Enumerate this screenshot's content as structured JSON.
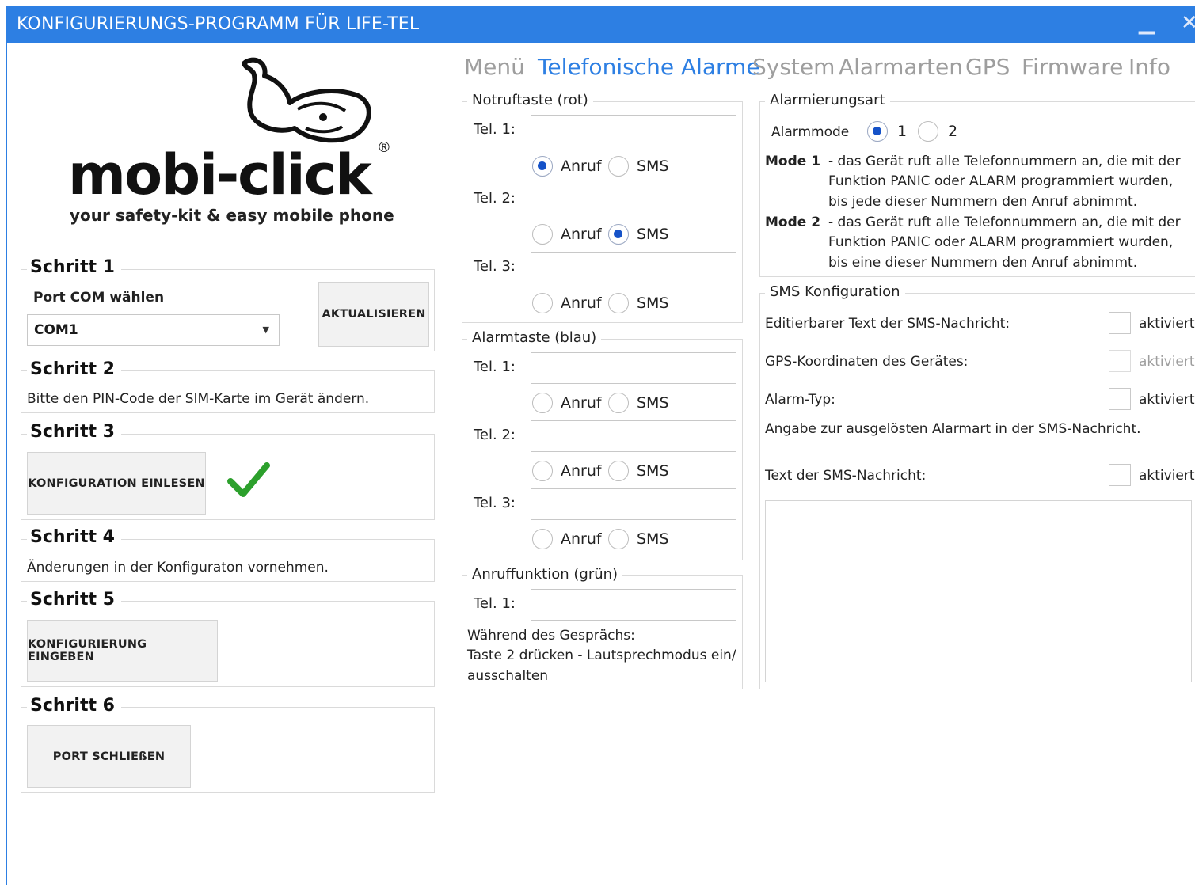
{
  "window": {
    "title": "KONFIGURIERUNGS-PROGRAMM FÜR LIFE-TEL",
    "minimize_glyph": "▁",
    "close_glyph": "✕"
  },
  "logo": {
    "brand": "mobi-click",
    "tagline": "your safety-kit & easy mobile phone",
    "registered": "®"
  },
  "steps": {
    "s1": {
      "title": "Schritt 1",
      "label": "Port COM wählen",
      "port_value": "COM1",
      "refresh_label": "AKTUALISIEREN"
    },
    "s2": {
      "title": "Schritt 2",
      "text": "Bitte den PIN-Code der SIM-Karte im Gerät ändern."
    },
    "s3": {
      "title": "Schritt 3",
      "button": "KONFIGURATION EINLESEN",
      "status": "success"
    },
    "s4": {
      "title": "Schritt 4",
      "text": "Änderungen in der Konfiguraton vornehmen."
    },
    "s5": {
      "title": "Schritt 5",
      "button": "KONFIGURIERUNG EINGEBEN"
    },
    "s6": {
      "title": "Schritt 6",
      "button": "PORT SCHLIEßEN"
    }
  },
  "tabs": [
    {
      "label": "Menü",
      "active": false
    },
    {
      "label": "Telefonische Alarme",
      "active": true
    },
    {
      "label": "System",
      "active": false
    },
    {
      "label": "Alarmarten",
      "active": false
    },
    {
      "label": "GPS",
      "active": false
    },
    {
      "label": "Firmware",
      "active": false
    },
    {
      "label": "Info",
      "active": false
    }
  ],
  "notruf": {
    "title": "Notruftaste (rot)",
    "rows": [
      {
        "label": "Tel. 1:",
        "value": "",
        "call": "Anruf",
        "sms": "SMS",
        "selected": "Anruf"
      },
      {
        "label": "Tel. 2:",
        "value": "",
        "call": "Anruf",
        "sms": "SMS",
        "selected": "SMS"
      },
      {
        "label": "Tel. 3:",
        "value": "",
        "call": "Anruf",
        "sms": "SMS",
        "selected": ""
      }
    ]
  },
  "alarm": {
    "title": "Alarmtaste (blau)",
    "rows": [
      {
        "label": "Tel. 1:",
        "value": "",
        "call": "Anruf",
        "sms": "SMS",
        "selected": ""
      },
      {
        "label": "Tel. 2:",
        "value": "",
        "call": "Anruf",
        "sms": "SMS",
        "selected": ""
      },
      {
        "label": "Tel. 3:",
        "value": "",
        "call": "Anruf",
        "sms": "SMS",
        "selected": ""
      }
    ]
  },
  "anruf": {
    "title": "Anruffunktion (grün)",
    "tel_label": "Tel. 1:",
    "tel_value": "",
    "note_1": "Während des Gesprächs:",
    "note_2": "Taste 2 drücken - Lautsprechmodus ein/",
    "note_3": "ausschalten"
  },
  "alarmierung": {
    "title": "Alarmierungsart",
    "mode_label": "Alarmmode",
    "options": [
      "1",
      "2"
    ],
    "selected": "1",
    "mode1_title": "Mode 1",
    "mode1_l1": "- das Gerät ruft alle Telefonnummern an, die mit der",
    "mode1_l2": "Funktion PANIC oder ALARM programmiert wurden,",
    "mode1_l3": "bis jede dieser Nummern den Anruf abnimmt.",
    "mode2_title": "Mode 2",
    "mode2_l1": "- das Gerät ruft alle Telefonnummern an, die mit der",
    "mode2_l2": "Funktion PANIC oder ALARM programmiert wurden,",
    "mode2_l3": "bis eine dieser Nummern den Anruf abnimmt."
  },
  "sms": {
    "title": "SMS Konfiguration",
    "opt1": {
      "label": "Editierbarer Text der SMS-Nachricht:",
      "check": "aktiviert",
      "enabled": true
    },
    "opt2": {
      "label": "GPS-Koordinaten des Gerätes:",
      "check": "aktiviert",
      "enabled": false
    },
    "opt3": {
      "label": "Alarm-Typ:",
      "check": "aktiviert",
      "enabled": true
    },
    "opt3_note": "Angabe zur ausgelösten Alarmart in der SMS-Nachricht.",
    "opt4": {
      "label": "Text der SMS-Nachricht:",
      "check": "aktiviert",
      "enabled": true
    },
    "message": ""
  },
  "colors": {
    "accent": "#2d7fe3",
    "radio_selected": "#1552c8",
    "check": "#2ca02c",
    "tab_inactive": "#9e9e9e"
  }
}
